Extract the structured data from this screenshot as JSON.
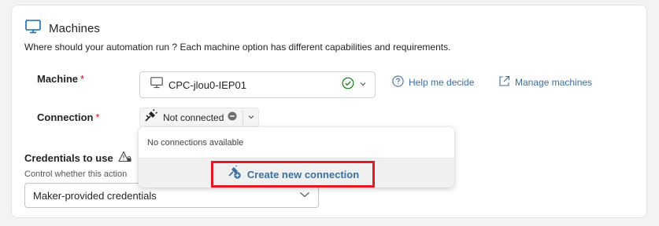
{
  "section": {
    "title": "Machines",
    "description": "Where should your automation run ? Each machine option has different capabilities and requirements."
  },
  "machine": {
    "label": "Machine",
    "required_mark": "*",
    "value": "CPC-jlou0-IEP01",
    "status": "available"
  },
  "links": {
    "help": "Help me decide",
    "manage": "Manage machines"
  },
  "connection": {
    "label": "Connection",
    "required_mark": "*",
    "value": "Not connected"
  },
  "credentials": {
    "label": "Credentials to use",
    "description": "Control whether this action",
    "value": "Maker-provided credentials"
  },
  "flyout": {
    "empty_text": "No connections available",
    "create_label": "Create new connection"
  },
  "colors": {
    "accent": "#3c6fa0",
    "highlight": "#e01b24",
    "required": "#c50f1f",
    "ok": "#107c10"
  }
}
